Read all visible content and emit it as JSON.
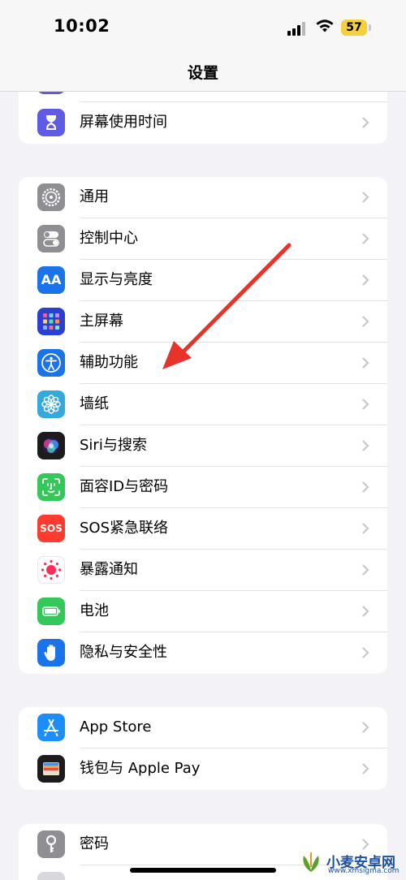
{
  "status": {
    "time": "10:02",
    "battery": "57"
  },
  "nav": {
    "title": "设置"
  },
  "groups": {
    "top": {
      "screen_time": "屏幕使用时间"
    },
    "main": {
      "general": "通用",
      "control_center": "控制中心",
      "display": "显示与亮度",
      "home_screen": "主屏幕",
      "accessibility": "辅助功能",
      "wallpaper": "墙纸",
      "siri": "Siri与搜索",
      "faceid": "面容ID与密码",
      "sos": "SOS紧急联络",
      "exposure": "暴露通知",
      "battery": "电池",
      "privacy": "隐私与安全性"
    },
    "store": {
      "appstore": "App Store",
      "wallet": "钱包与 Apple Pay"
    },
    "bottom": {
      "passwords": "密码"
    }
  },
  "icons": {
    "display_text": "AA",
    "sos_text": "SOS"
  },
  "watermark": {
    "title": "小麦安卓网",
    "url": "www.xmsigma.com"
  },
  "colors": {
    "screen_time": "#5e5ce6",
    "general": "#8e8e93",
    "control_center": "#8e8e93",
    "display": "#1a73e8",
    "home_screen": "#2b3fd0",
    "accessibility": "#1a73e8",
    "wallpaper": "#34aadc",
    "siri": "#1c1c1e",
    "faceid": "#34c759",
    "sos": "#ff3b30",
    "exposure": "#ffffff",
    "battery": "#34c759",
    "privacy": "#1a73e8",
    "appstore": "#1c8ef9",
    "wallet": "#1c1c1e",
    "passwords": "#8e8e93",
    "annotation_arrow": "#e8332a"
  }
}
